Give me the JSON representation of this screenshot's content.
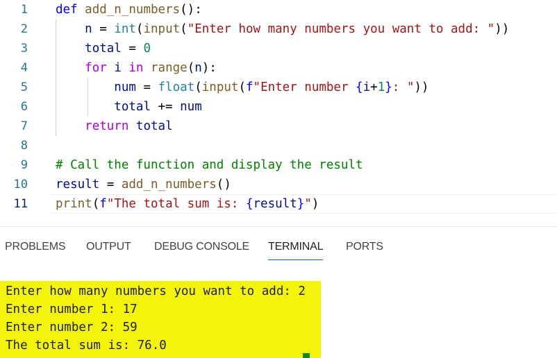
{
  "editor": {
    "lines": [
      {
        "num": "1",
        "tokens": [
          [
            "kw",
            "def "
          ],
          [
            "fn",
            "add_n_numbers"
          ],
          [
            "plain",
            "():"
          ]
        ]
      },
      {
        "num": "2",
        "tokens": [
          [
            "plain",
            "    "
          ],
          [
            "var",
            "n"
          ],
          [
            "plain",
            " = "
          ],
          [
            "bi",
            "int"
          ],
          [
            "plain",
            "("
          ],
          [
            "fn",
            "input"
          ],
          [
            "plain",
            "("
          ],
          [
            "str",
            "\"Enter how many numbers you want to add: \""
          ],
          [
            "plain",
            "))"
          ]
        ]
      },
      {
        "num": "3",
        "tokens": [
          [
            "plain",
            "    "
          ],
          [
            "var",
            "total"
          ],
          [
            "plain",
            " = "
          ],
          [
            "num",
            "0"
          ]
        ]
      },
      {
        "num": "4",
        "tokens": [
          [
            "plain",
            "    "
          ],
          [
            "ctl",
            "for "
          ],
          [
            "var",
            "i"
          ],
          [
            "ctl",
            " in "
          ],
          [
            "fn",
            "range"
          ],
          [
            "plain",
            "("
          ],
          [
            "var",
            "n"
          ],
          [
            "plain",
            "):"
          ]
        ]
      },
      {
        "num": "5",
        "tokens": [
          [
            "plain",
            "        "
          ],
          [
            "var",
            "num"
          ],
          [
            "plain",
            " = "
          ],
          [
            "bi",
            "float"
          ],
          [
            "plain",
            "("
          ],
          [
            "fn",
            "input"
          ],
          [
            "plain",
            "("
          ],
          [
            "kw",
            "f"
          ],
          [
            "str",
            "\"Enter number "
          ],
          [
            "ph",
            "{"
          ],
          [
            "var",
            "i"
          ],
          [
            "plain",
            "+"
          ],
          [
            "num",
            "1"
          ],
          [
            "ph",
            "}"
          ],
          [
            "str",
            ": \""
          ],
          [
            "plain",
            "))"
          ]
        ]
      },
      {
        "num": "6",
        "tokens": [
          [
            "plain",
            "        "
          ],
          [
            "var",
            "total"
          ],
          [
            "plain",
            " += "
          ],
          [
            "var",
            "num"
          ]
        ]
      },
      {
        "num": "7",
        "tokens": [
          [
            "plain",
            "    "
          ],
          [
            "ctl",
            "return "
          ],
          [
            "var",
            "total"
          ]
        ]
      },
      {
        "num": "8",
        "tokens": []
      },
      {
        "num": "9",
        "tokens": [
          [
            "cmt",
            "# Call the function and display the result"
          ]
        ]
      },
      {
        "num": "10",
        "tokens": [
          [
            "var",
            "result"
          ],
          [
            "plain",
            " = "
          ],
          [
            "fn",
            "add_n_numbers"
          ],
          [
            "plain",
            "()"
          ]
        ]
      },
      {
        "num": "11",
        "tokens": [
          [
            "fn",
            "print"
          ],
          [
            "plain",
            "("
          ],
          [
            "kw",
            "f"
          ],
          [
            "str",
            "\"The total sum is: "
          ],
          [
            "ph",
            "{"
          ],
          [
            "var",
            "result"
          ],
          [
            "ph",
            "}"
          ],
          [
            "str",
            "\""
          ],
          [
            "plain",
            ")"
          ]
        ]
      }
    ]
  },
  "panel": {
    "tabs": [
      "PROBLEMS",
      "OUTPUT",
      "DEBUG CONSOLE",
      "TERMINAL",
      "PORTS"
    ],
    "active_tab": "TERMINAL"
  },
  "terminal": {
    "lines": [
      "Enter how many numbers you want to add: 2",
      "Enter number 1: 17",
      "Enter number 2: 59",
      "The total sum is: 76.0"
    ],
    "highlight_color": "#f4f40a"
  }
}
